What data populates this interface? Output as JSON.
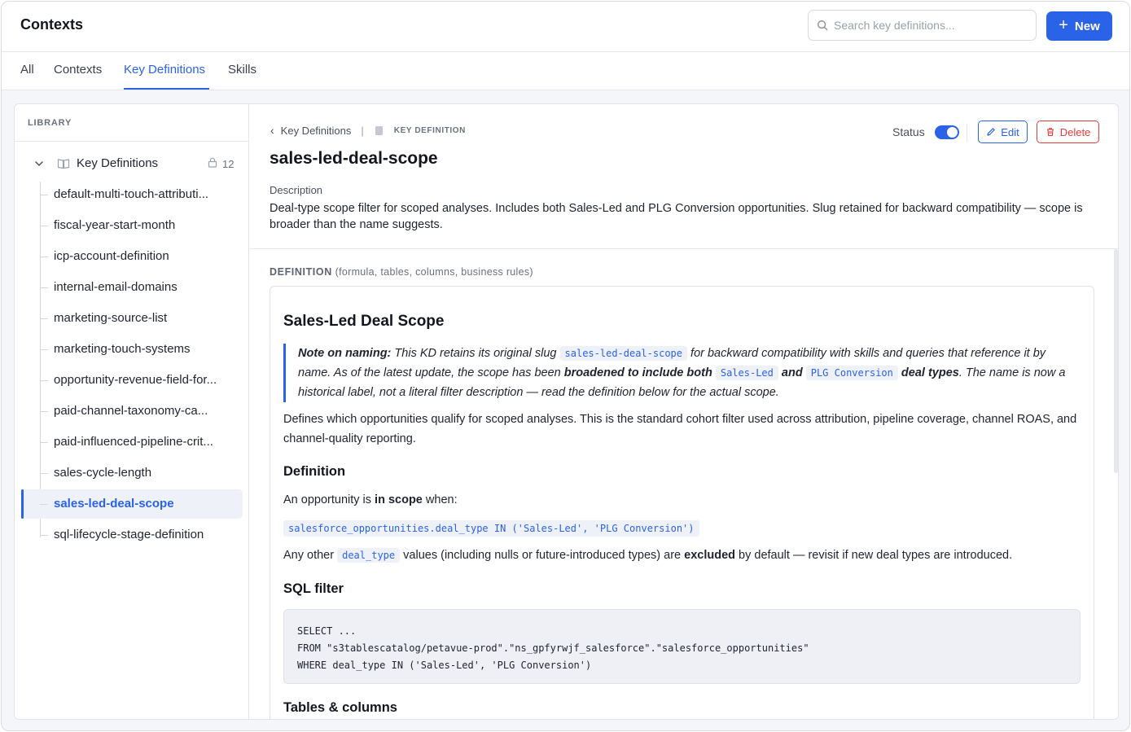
{
  "header": {
    "title": "Contexts",
    "search_placeholder": "Search key definitions...",
    "new_label": "New"
  },
  "tabs": [
    {
      "label": "All"
    },
    {
      "label": "Contexts"
    },
    {
      "label": "Key Definitions",
      "active": true
    },
    {
      "label": "Skills"
    }
  ],
  "sidebar": {
    "section_label": "LIBRARY",
    "folder_label": "Key Definitions",
    "folder_count": "12",
    "items": [
      {
        "label": "default-multi-touch-attributi..."
      },
      {
        "label": "fiscal-year-start-month"
      },
      {
        "label": "icp-account-definition"
      },
      {
        "label": "internal-email-domains"
      },
      {
        "label": "marketing-source-list"
      },
      {
        "label": "marketing-touch-systems"
      },
      {
        "label": "opportunity-revenue-field-for..."
      },
      {
        "label": "paid-channel-taxonomy-ca..."
      },
      {
        "label": "paid-influenced-pipeline-crit..."
      },
      {
        "label": "sales-cycle-length"
      },
      {
        "label": "sales-led-deal-scope",
        "selected": true
      },
      {
        "label": "sql-lifecycle-stage-definition"
      }
    ]
  },
  "detail": {
    "breadcrumb_back": "Key Definitions",
    "breadcrumb_type": "KEY DEFINITION",
    "title": "sales-led-deal-scope",
    "status_label": "Status",
    "status_on": true,
    "edit_label": "Edit",
    "delete_label": "Delete",
    "description_label": "Description",
    "description": "Deal-type scope filter for scoped analyses. Includes both Sales-Led and PLG Conversion opportunities. Slug retained for backward compatibility — scope is broader than the name suggests.",
    "definition_label": "DEFINITION",
    "definition_hint": "(formula, tables, columns, business rules)"
  },
  "doc": {
    "heading": "Sales-Led Deal Scope",
    "note_bold": "Note on naming:",
    "note_t1": "This KD retains its original slug",
    "note_code1": "sales-led-deal-scope",
    "note_t2": "for backward compatibility with skills and queries that reference it by name. As of the latest update, the scope has been",
    "note_bold2": "broadened to include both",
    "note_code2": "Sales-Led",
    "note_and": "and",
    "note_code3": "PLG Conversion",
    "note_bold3": "deal types",
    "note_t3": ". The name is now a historical label, not a literal filter description — read the definition below for the actual scope.",
    "intro": "Defines which opportunities qualify for scoped analyses. This is the standard cohort filter used across attribution, pipeline coverage, channel ROAS, and channel-quality reporting.",
    "def_heading": "Definition",
    "scope_t1": "An opportunity is",
    "scope_bold": "in scope",
    "scope_t2": "when:",
    "scope_code": "salesforce_opportunities.deal_type IN ('Sales-Led', 'PLG Conversion')",
    "other_t1": "Any other",
    "other_code": "deal_type",
    "other_t2": "values (including nulls or future-introduced types) are",
    "other_bold": "excluded",
    "other_t3": "by default — revisit if new deal types are introduced.",
    "sql_heading": "SQL filter",
    "sql_code": "SELECT ...\nFROM \"s3tablescatalog/petavue-prod\".\"ns_gpfyrwjf_salesforce\".\"salesforce_opportunities\"\nWHERE deal_type IN ('Sales-Led', 'PLG Conversion')",
    "tables_heading": "Tables & columns"
  },
  "colors": {
    "accent": "#2a62e8",
    "danger": "#e03c3c"
  }
}
